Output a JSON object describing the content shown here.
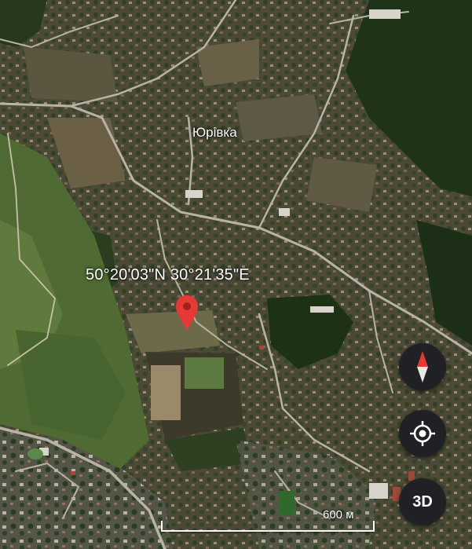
{
  "map": {
    "place_label": "Юрівка",
    "coordinates": "50°20'03\"N 30°21'35\"E",
    "scale_label": "600 м"
  },
  "controls": {
    "compass_icon": "compass-icon",
    "locate_icon": "my-location-icon",
    "three_d_label": "3D"
  },
  "colors": {
    "pin": "#e53935",
    "button_bg": "#202124",
    "compass_red": "#e53935"
  }
}
